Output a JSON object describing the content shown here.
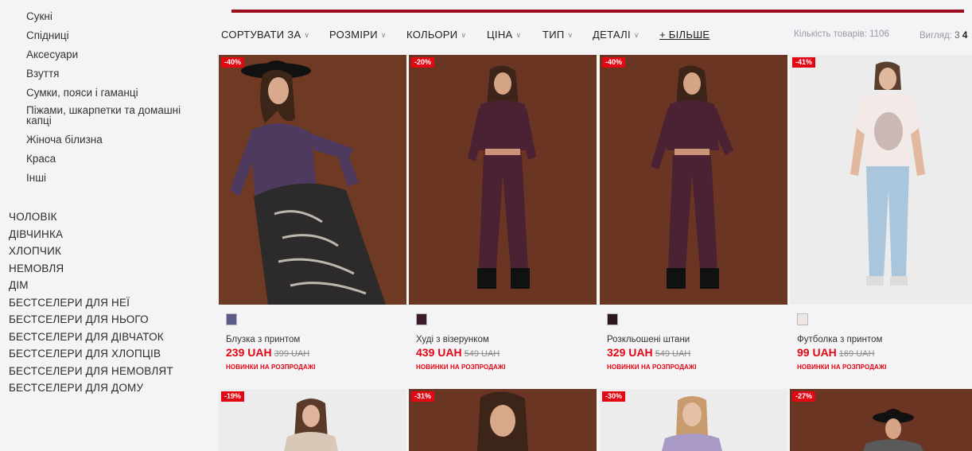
{
  "sidebar": {
    "sub_items": [
      "Сукні",
      "Спідниці",
      "Аксесуари",
      "Взуття",
      "Сумки, пояси і гаманці",
      "Піжами, шкарпетки та домашні капці",
      "Жіноча білизна",
      "Краса",
      "Інші"
    ],
    "main_items": [
      "ЧОЛОВІК",
      "ДІВЧИНКА",
      "ХЛОПЧИК",
      "НЕМОВЛЯ",
      "ДІМ",
      "БЕСТСЕЛЕРИ ДЛЯ НЕЇ",
      "БЕСТСЕЛЕРИ ДЛЯ НЬОГО",
      "БЕСТСЕЛЕРИ ДЛЯ ДІВЧАТОК",
      "БЕСТСЕЛЕРИ ДЛЯ ХЛОПЦІВ",
      "БЕСТСЕЛЕРИ ДЛЯ НЕМОВЛЯТ",
      "БЕСТСЕЛЕРИ ДЛЯ ДОМУ"
    ]
  },
  "filters": {
    "sort": "СОРТУВАТИ ЗА",
    "sizes": "РОЗМІРИ",
    "colors": "КОЛЬОРИ",
    "price": "ЦІНА",
    "type": "ТИП",
    "details": "ДЕТАЛІ",
    "more": "+ БІЛЬШЕ",
    "count_label": "Кількість товарів: 1106",
    "view_label": "Вигляд:",
    "view_opt3": "3",
    "view_opt4": "4"
  },
  "products": [
    {
      "badge": "-40%",
      "name": "Блузка з принтом",
      "price": "239 UAH",
      "old_price": "399 UAH",
      "promo": "НОВИНКИ НА РОЗПРОДАЖІ",
      "swatch_color": "#5b5a8a"
    },
    {
      "badge": "-20%",
      "name": "Худі з візерунком",
      "price": "439 UAH",
      "old_price": "549 UAH",
      "promo": "НОВИНКИ НА РОЗПРОДАЖІ",
      "swatch_color": "#3a1c2a"
    },
    {
      "badge": "-40%",
      "name": "Розкльошені штани",
      "price": "329 UAH",
      "old_price": "549 UAH",
      "promo": "НОВИНКИ НА РОЗПРОДАЖІ",
      "swatch_color": "#2b1720"
    },
    {
      "badge": "-41%",
      "name": "Футболка з принтом",
      "price": "99 UAH",
      "old_price": "169 UAH",
      "promo": "НОВИНКИ НА РОЗПРОДАЖІ",
      "swatch_color": "#efe7e4"
    }
  ],
  "next_row_badges": [
    "-19%",
    "-31%",
    "-30%",
    "-27%"
  ],
  "colors": {
    "accent_red": "#e30613",
    "top_line": "#9d0c1b",
    "photo_brown": "#6e3a23"
  }
}
